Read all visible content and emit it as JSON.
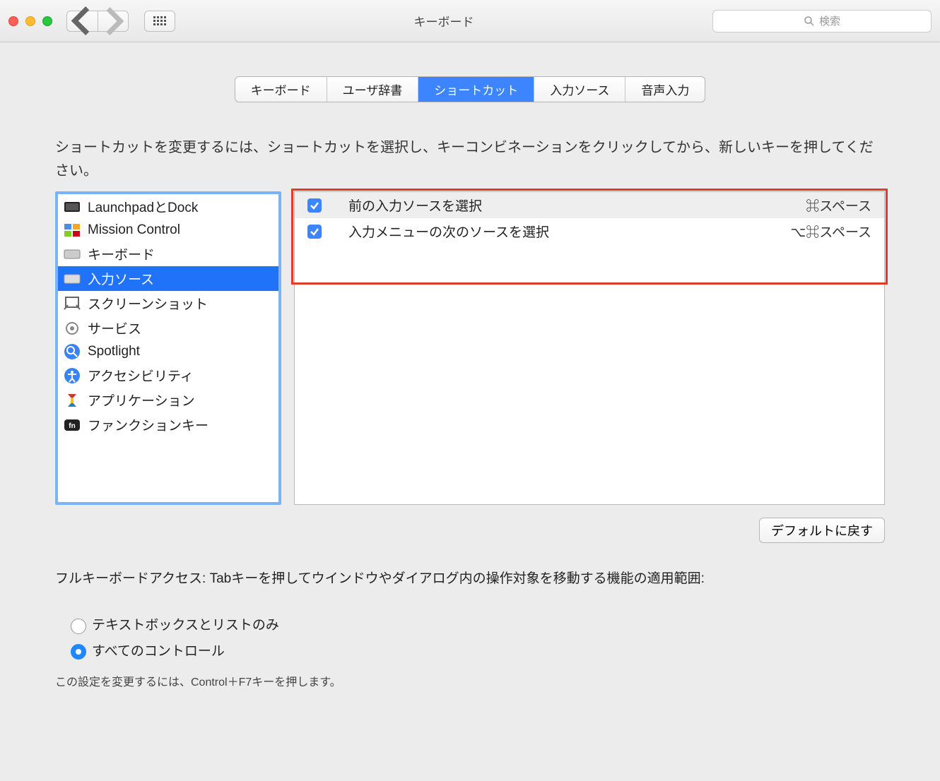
{
  "window": {
    "title": "キーボード"
  },
  "search": {
    "placeholder": "検索"
  },
  "tabs": [
    "キーボード",
    "ユーザ辞書",
    "ショートカット",
    "入力ソース",
    "音声入力"
  ],
  "active_tab_index": 2,
  "instruction": "ショートカットを変更するには、ショートカットを選択し、キーコンビネーションをクリックしてから、新しいキーを押してください。",
  "categories": [
    {
      "label": "LaunchpadとDock",
      "icon": "launchpad"
    },
    {
      "label": "Mission Control",
      "icon": "mission-control"
    },
    {
      "label": "キーボード",
      "icon": "keyboard"
    },
    {
      "label": "入力ソース",
      "icon": "keyboard",
      "selected": true
    },
    {
      "label": "スクリーンショット",
      "icon": "screenshot"
    },
    {
      "label": "サービス",
      "icon": "services"
    },
    {
      "label": "Spotlight",
      "icon": "spotlight"
    },
    {
      "label": "アクセシビリティ",
      "icon": "accessibility"
    },
    {
      "label": "アプリケーション",
      "icon": "app-shortcuts"
    },
    {
      "label": "ファンクションキー",
      "icon": "fn"
    }
  ],
  "shortcuts": [
    {
      "checked": true,
      "label": "前の入力ソースを選択",
      "key": "⌘スペース"
    },
    {
      "checked": true,
      "label": "入力メニューの次のソースを選択",
      "key": "⌥⌘スペース"
    }
  ],
  "defaults_button": "デフォルトに戻す",
  "full_keyboard_access": {
    "label": "フルキーボードアクセス: Tabキーを押してウインドウやダイアログ内の操作対象を移動する機能の適用範囲:",
    "options": [
      "テキストボックスとリストのみ",
      "すべてのコントロール"
    ],
    "selected_index": 1,
    "hint": "この設定を変更するには、Control＋F7キーを押します。"
  }
}
